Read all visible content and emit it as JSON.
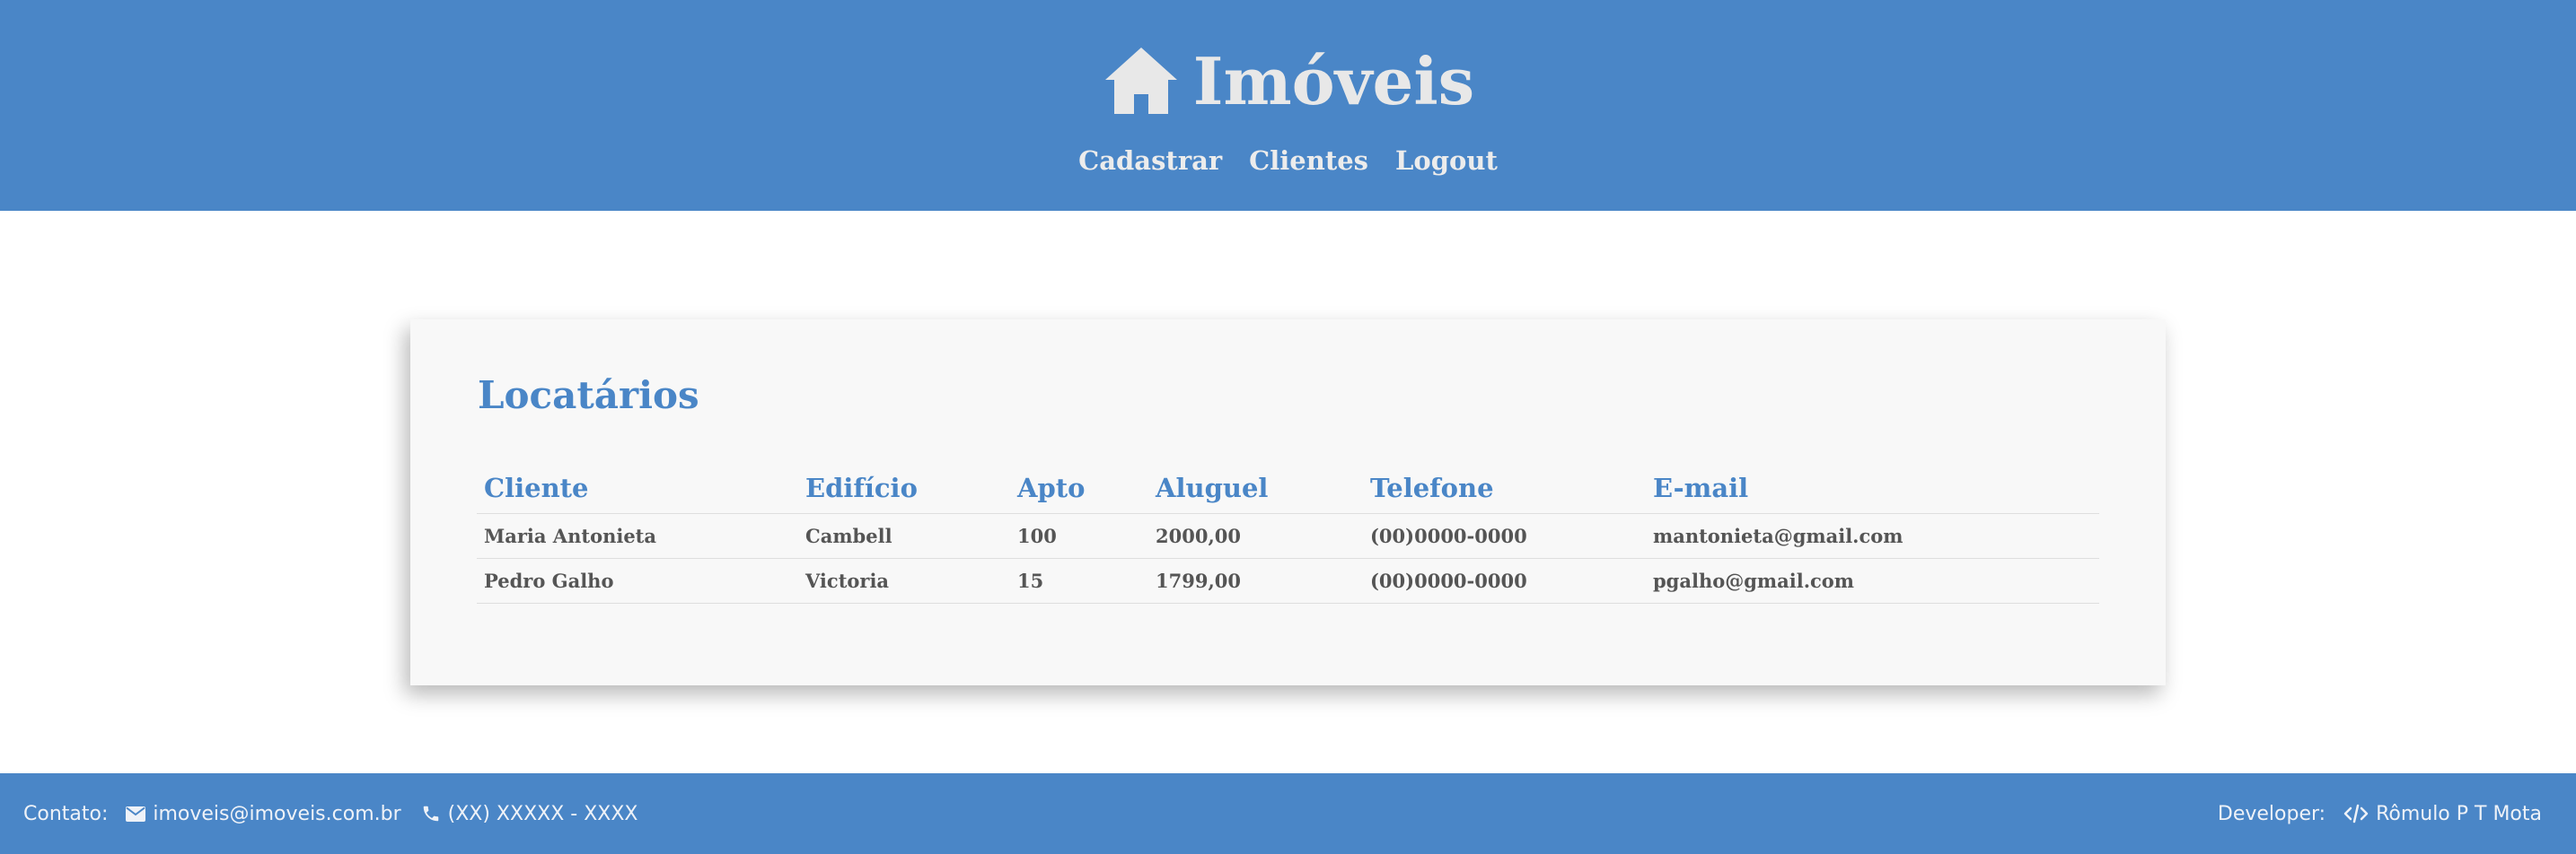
{
  "header": {
    "title": "Imóveis",
    "icon": "house-icon",
    "nav": [
      {
        "label": "Cadastrar"
      },
      {
        "label": "Clientes"
      },
      {
        "label": "Logout"
      }
    ]
  },
  "main": {
    "title": "Locatários",
    "columns": [
      "Cliente",
      "Edifício",
      "Apto",
      "Aluguel",
      "Telefone",
      "E-mail"
    ],
    "rows": [
      [
        "Maria Antonieta",
        "Cambell",
        "100",
        "2000,00",
        "(00)0000-0000",
        "mantonieta@gmail.com"
      ],
      [
        "Pedro Galho",
        "Victoria",
        "15",
        "1799,00",
        "(00)0000-0000",
        "pgalho@gmail.com"
      ]
    ]
  },
  "footer": {
    "contact_label": "Contato:",
    "email": "imoveis@imoveis.com.br",
    "phone": "(XX) XXXXX - XXXX",
    "developer_label": "Developer:",
    "developer_name": "Rômulo P T Mota",
    "icons": [
      "envelope-icon",
      "phone-icon",
      "code-icon"
    ]
  },
  "colors": {
    "primary": "#4a86c7",
    "header_text": "#e8e8e8",
    "card_background": "#f8f8f8",
    "table_text": "#555555"
  }
}
